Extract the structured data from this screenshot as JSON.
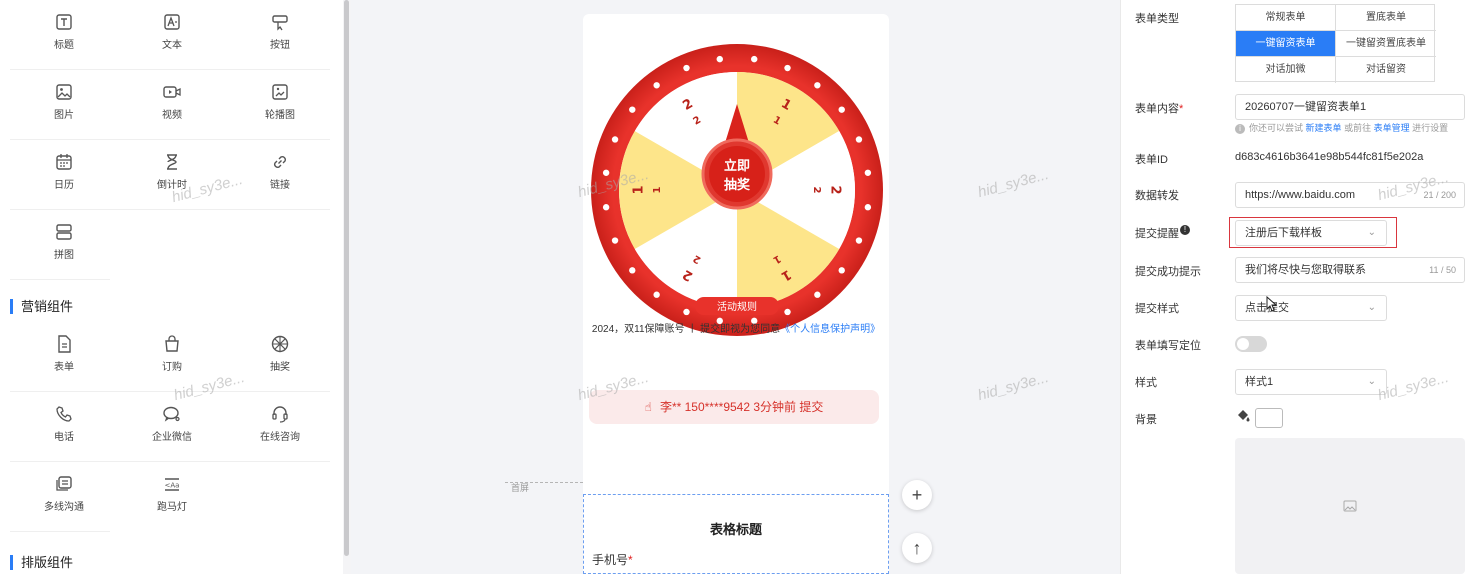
{
  "left_panel": {
    "basic_items": [
      {
        "label": "标题",
        "icon": "title-icon"
      },
      {
        "label": "文本",
        "icon": "text-icon"
      },
      {
        "label": "按钮",
        "icon": "button-icon"
      },
      {
        "label": "图片",
        "icon": "image-icon"
      },
      {
        "label": "视频",
        "icon": "video-icon"
      },
      {
        "label": "轮播图",
        "icon": "carousel-icon"
      },
      {
        "label": "日历",
        "icon": "calendar-icon"
      },
      {
        "label": "倒计时",
        "icon": "hourglass-icon"
      },
      {
        "label": "链接",
        "icon": "link-icon"
      },
      {
        "label": "拼图",
        "icon": "puzzle-icon"
      }
    ],
    "marketing_title": "营销组件",
    "marketing_items": [
      {
        "label": "表单",
        "icon": "form-icon"
      },
      {
        "label": "订购",
        "icon": "shopping-bag-icon"
      },
      {
        "label": "抽奖",
        "icon": "lottery-wheel-icon"
      },
      {
        "label": "电话",
        "icon": "phone-icon"
      },
      {
        "label": "企业微信",
        "icon": "wechat-work-icon"
      },
      {
        "label": "在线咨询",
        "icon": "headset-icon"
      },
      {
        "label": "多线沟通",
        "icon": "multi-line-chat-icon"
      },
      {
        "label": "跑马灯",
        "icon": "marquee-icon"
      }
    ],
    "layout_title": "排版组件"
  },
  "canvas": {
    "wheel": {
      "center_line1": "立即",
      "center_line2": "抽奖",
      "rules": "活动规则",
      "segment_prizes": [
        "1",
        "2",
        "1",
        "2",
        "1",
        "2"
      ],
      "segment_subs": [
        "1",
        "2",
        "1",
        "2",
        "1",
        "2"
      ],
      "colors": {
        "ring": "#e8322b",
        "yellow": "#fde58a",
        "white": "#ffffff",
        "center": "#d9231c"
      }
    },
    "disclaimer_text": "2024，双11保障账号 丨 提交即视为您同意",
    "disclaimer_link": "《个人信息保护声明》",
    "ticker_text": "李** 150****9542 3分钟前 提交",
    "fold_label": "首屏",
    "form_title": "表格标题",
    "phone_label": "手机号",
    "required_mark": "*",
    "add_button": "+",
    "up_button": "↑",
    "watermark": "hid_sy3e..."
  },
  "right_panel": {
    "form_type_label": "表单类型",
    "form_types": [
      "常规表单",
      "置底表单",
      "一键留资表单",
      "一键留资置底表单",
      "对话加微",
      "对话留资"
    ],
    "form_type_active": "一键留资表单",
    "form_content_label": "表单内容",
    "required_mark": "*",
    "form_content_value": "20260707一键留资表单1",
    "hint_prefix": "你还可以尝试",
    "hint_link1": "新建表单",
    "hint_mid": "或前往",
    "hint_link2": "表单管理",
    "hint_suffix": "进行设置",
    "form_id_label": "表单ID",
    "form_id_value": "d683c4616b3641e98b544fc81f5e202a",
    "forward_label": "数据转发",
    "forward_value": "https://www.baidu.com",
    "forward_count": "21 / 200",
    "submit_remind_label": "提交提醒",
    "submit_remind_value": "注册后下载样板",
    "success_tip_label": "提交成功提示",
    "success_tip_value": "我们将尽快与您取得联系",
    "success_tip_count": "11 / 50",
    "submit_style_label": "提交样式",
    "submit_style_value": "点击提交",
    "locate_label": "表单填写定位",
    "style_label": "样式",
    "style_value": "样式1",
    "background_label": "背景",
    "accent_color": "#2a7df6"
  }
}
